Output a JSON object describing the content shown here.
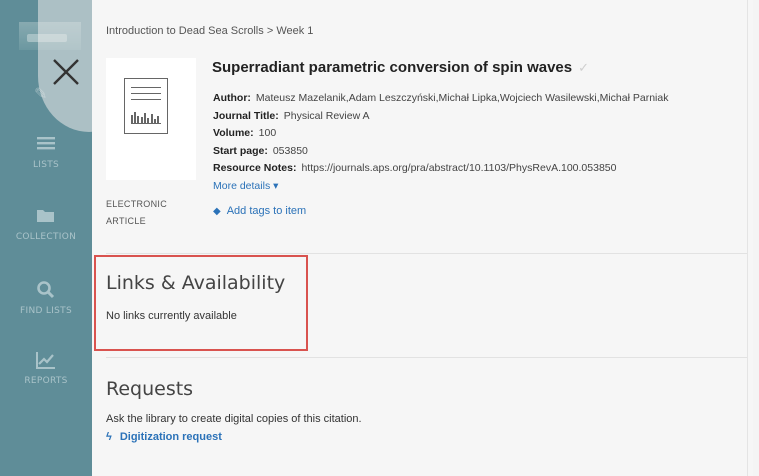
{
  "sidebar": {
    "items": [
      {
        "label": "LISTS",
        "icon": "list-icon"
      },
      {
        "label": "COLLECTION",
        "icon": "folder-icon"
      },
      {
        "label": "FIND LISTS",
        "icon": "search-icon"
      },
      {
        "label": "REPORTS",
        "icon": "chart-icon"
      }
    ]
  },
  "breadcrumb": {
    "course": "Introduction to Dead Sea Scrolls",
    "separator": ">",
    "week": "Week 1"
  },
  "item": {
    "type": "ELECTRONIC ARTICLE",
    "title": "Superradiant parametric conversion of spin waves",
    "meta": [
      {
        "key": "Author:",
        "value": "Mateusz Mazelanik,Adam Leszczyński,Michał Lipka,Wojciech Wasilewski,Michał Parniak"
      },
      {
        "key": "Journal Title:",
        "value": "Physical Review A"
      },
      {
        "key": "Volume:",
        "value": "100"
      },
      {
        "key": "Start page:",
        "value": "053850"
      },
      {
        "key": "Resource Notes:",
        "value": "https://journals.aps.org/pra/abstract/10.1103/PhysRevA.100.053850"
      }
    ],
    "more_details": "More details ▾",
    "add_tags": "Add tags to item"
  },
  "links": {
    "heading": "Links & Availability",
    "text": "No links currently available"
  },
  "requests": {
    "heading": "Requests",
    "text": "Ask the library to create digital copies of this citation.",
    "link": "Digitization request"
  },
  "colors": {
    "sidebar": "#5f8d98",
    "link": "#2b72b8",
    "highlight": "#d9534f"
  }
}
